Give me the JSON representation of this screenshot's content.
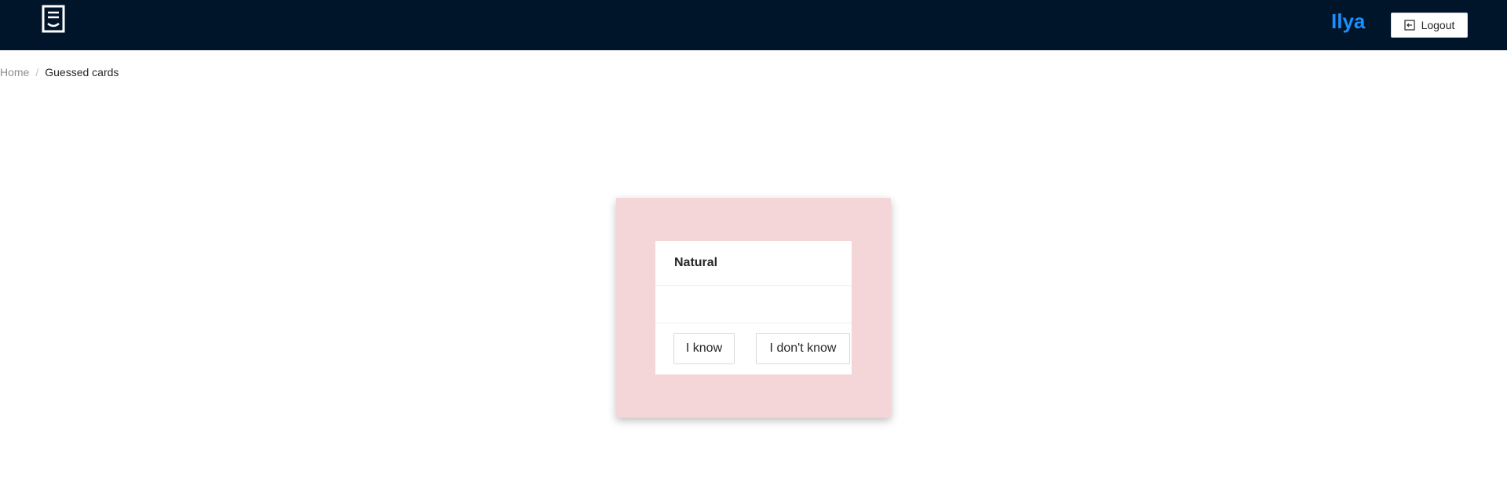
{
  "header": {
    "logo_icon": "document-icon",
    "user_name": "Ilya",
    "logout_label": "Logout",
    "logout_icon": "logout-icon",
    "background": "#001529",
    "accent": "#1890ff"
  },
  "breadcrumb": {
    "home": "Home",
    "separator": "/",
    "current": "Guessed cards"
  },
  "card": {
    "frame_color": "#f4d6d8",
    "title": "Natural",
    "body": "",
    "know_label": "I know",
    "dont_know_label": "I don't know"
  }
}
